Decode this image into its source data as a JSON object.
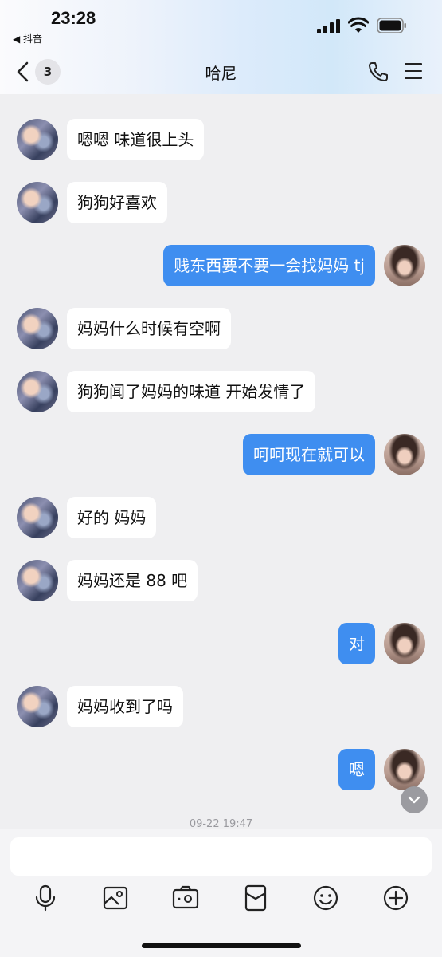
{
  "status_bar": {
    "time": "23:28",
    "back_app": "◀ 抖音"
  },
  "header": {
    "title": "哈尼",
    "unread_count": "3"
  },
  "messages": [
    {
      "side": "in",
      "text": "嗯嗯 味道很上头"
    },
    {
      "side": "in",
      "text": "狗狗好喜欢"
    },
    {
      "side": "out",
      "text": "贱东西要不要一会找妈妈 tj"
    },
    {
      "side": "in",
      "text": "妈妈什么时候有空啊"
    },
    {
      "side": "in",
      "text": "狗狗闻了妈妈的味道 开始发情了"
    },
    {
      "side": "out",
      "text": "呵呵现在就可以"
    },
    {
      "side": "in",
      "text": "好的 妈妈"
    },
    {
      "side": "in",
      "text": "妈妈还是 88 吧"
    },
    {
      "side": "out",
      "text": "对"
    },
    {
      "side": "in",
      "text": "妈妈收到了吗"
    },
    {
      "side": "out",
      "text": "嗯"
    }
  ],
  "timestamp": "09-22 19:47",
  "input": {
    "placeholder": "",
    "value": ""
  },
  "toolbar": [
    "microphone-icon",
    "image-icon",
    "camera-icon",
    "red-envelope-icon",
    "emoji-icon",
    "plus-icon"
  ],
  "colors": {
    "outgoing_bubble": "#3f8ef0",
    "incoming_bubble": "#ffffff",
    "background": "#efeff1"
  }
}
